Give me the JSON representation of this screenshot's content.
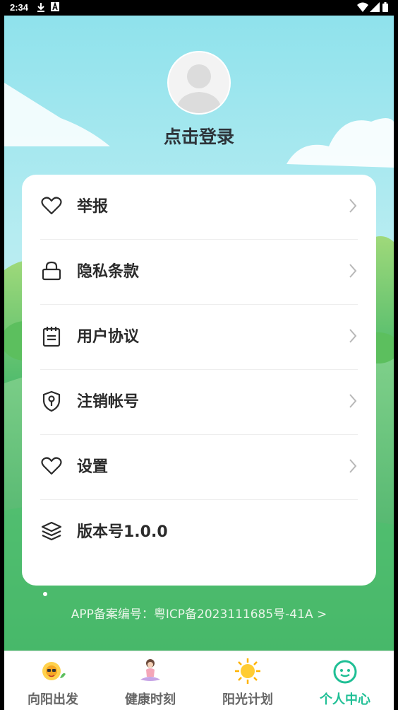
{
  "status_bar": {
    "time": "2:34"
  },
  "profile": {
    "login_label": "点击登录"
  },
  "menu": {
    "items": [
      {
        "label": "举报",
        "icon": "heart-icon"
      },
      {
        "label": "隐私条款",
        "icon": "lock-icon"
      },
      {
        "label": "用户协议",
        "icon": "clipboard-icon"
      },
      {
        "label": "注销帐号",
        "icon": "shield-key-icon"
      },
      {
        "label": "设置",
        "icon": "heart-icon"
      },
      {
        "label": "版本号1.0.0",
        "icon": "layers-icon"
      }
    ]
  },
  "footer": {
    "icp_text": "APP备案编号：粤ICP备2023111685号-41A >"
  },
  "tabbar": {
    "tabs": [
      {
        "label": "向阳出发",
        "icon": "sunflower-icon"
      },
      {
        "label": "健康时刻",
        "icon": "yoga-icon"
      },
      {
        "label": "阳光计划",
        "icon": "sun-icon"
      },
      {
        "label": "个人中心",
        "icon": "smile-face-icon"
      }
    ],
    "active_index": 3,
    "active_color": "#1fbf95",
    "inactive_color": "#666666"
  }
}
